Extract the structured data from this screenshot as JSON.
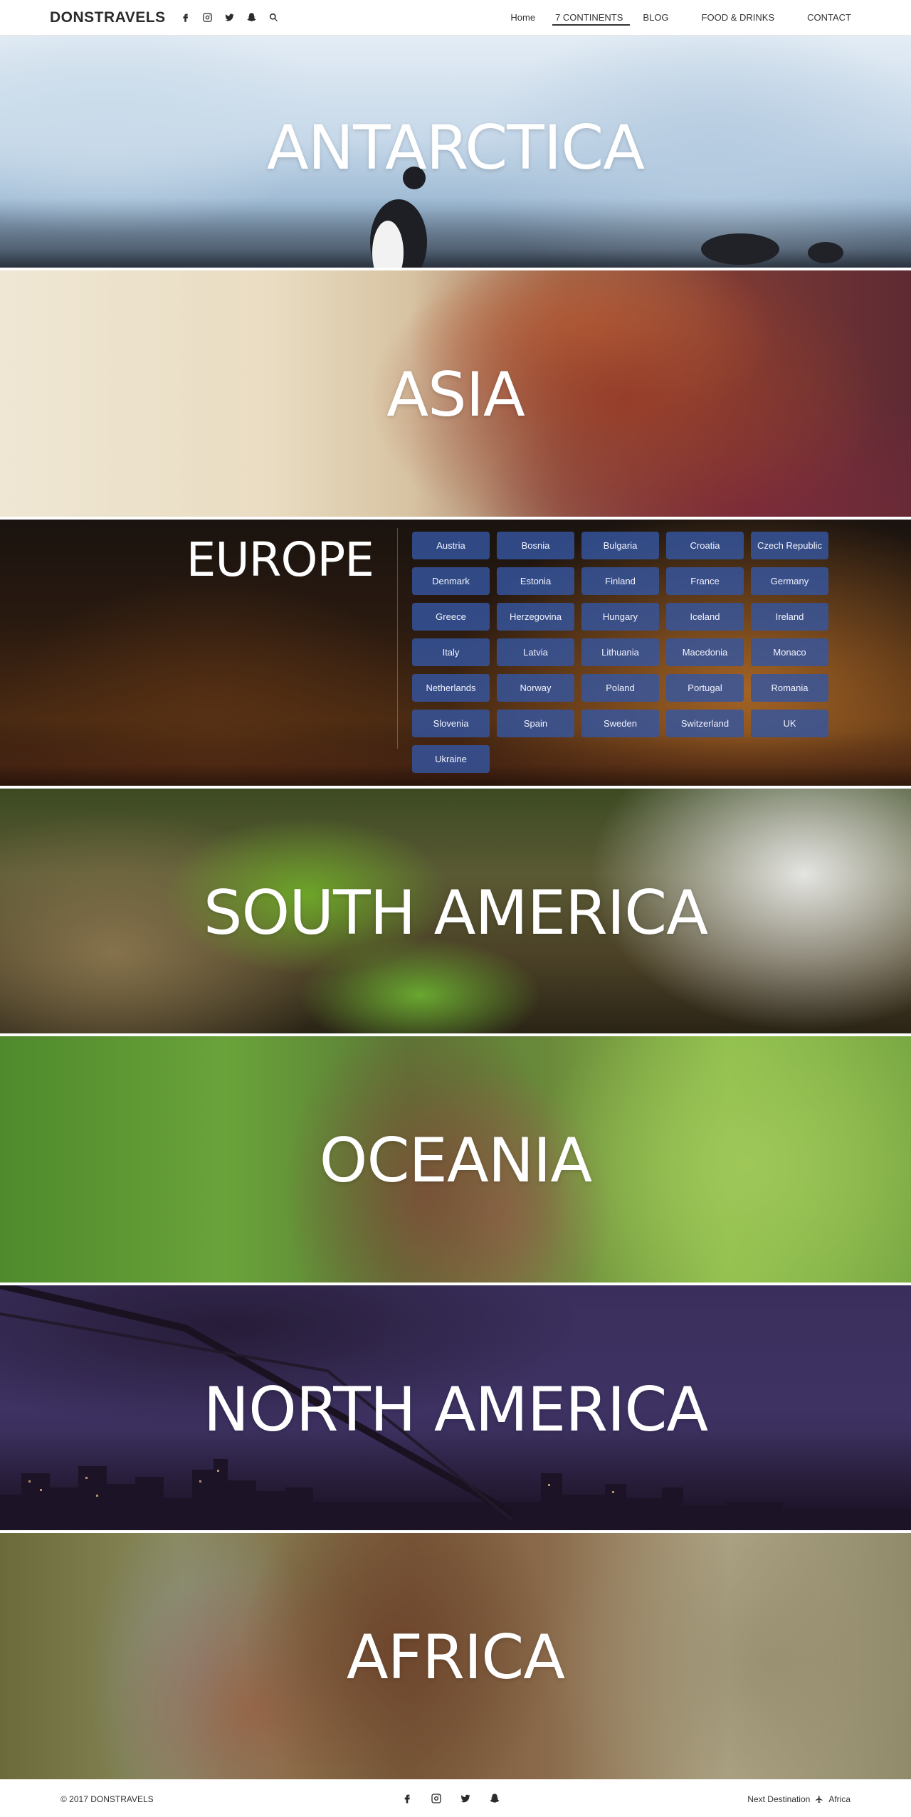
{
  "header": {
    "brand": "DONSTRAVELS",
    "social_icons": [
      "facebook-icon",
      "instagram-icon",
      "twitter-icon",
      "snapchat-icon",
      "search-icon"
    ],
    "nav": [
      {
        "label": "Home",
        "active": false
      },
      {
        "label": "7 CONTINENTS",
        "active": true
      },
      {
        "label": "BLOG",
        "active": false
      },
      {
        "label": "FOOD & DRINKS",
        "active": false
      },
      {
        "label": "CONTACT",
        "active": false
      }
    ]
  },
  "sections": {
    "antarctica": {
      "title": "ANTARCTICA"
    },
    "asia": {
      "title": "ASIA"
    },
    "europe": {
      "title": "EUROPE",
      "countries": [
        "Austria",
        "Bosnia",
        "Bulgaria",
        "Croatia",
        "Czech Republic",
        "Denmark",
        "Estonia",
        "Finland",
        "France",
        "Germany",
        "Greece",
        "Herzegovina",
        "Hungary",
        "Iceland",
        "Ireland",
        "Italy",
        "Latvia",
        "Lithuania",
        "Macedonia",
        "Monaco",
        "Netherlands",
        "Norway",
        "Poland",
        "Portugal",
        "Romania",
        "Slovenia",
        "Spain",
        "Sweden",
        "Switzerland",
        "UK",
        "Ukraine"
      ]
    },
    "southamerica": {
      "title": "SOUTH AMERICA"
    },
    "oceania": {
      "title": "OCEANIA"
    },
    "northamerica": {
      "title": "NORTH AMERICA"
    },
    "africa": {
      "title": "AFRICA"
    }
  },
  "footer": {
    "copyright": "© 2017 DONSTRAVELS",
    "social_icons": [
      "facebook-icon",
      "instagram-icon",
      "twitter-icon",
      "snapchat-icon"
    ],
    "next_label": "Next Destination",
    "next_icon": "plane-icon",
    "next_value": "Africa"
  },
  "colors": {
    "country_button_bg": "#3456a0",
    "header_bg": "#ffffff",
    "text_dark": "#2b2b2b"
  }
}
